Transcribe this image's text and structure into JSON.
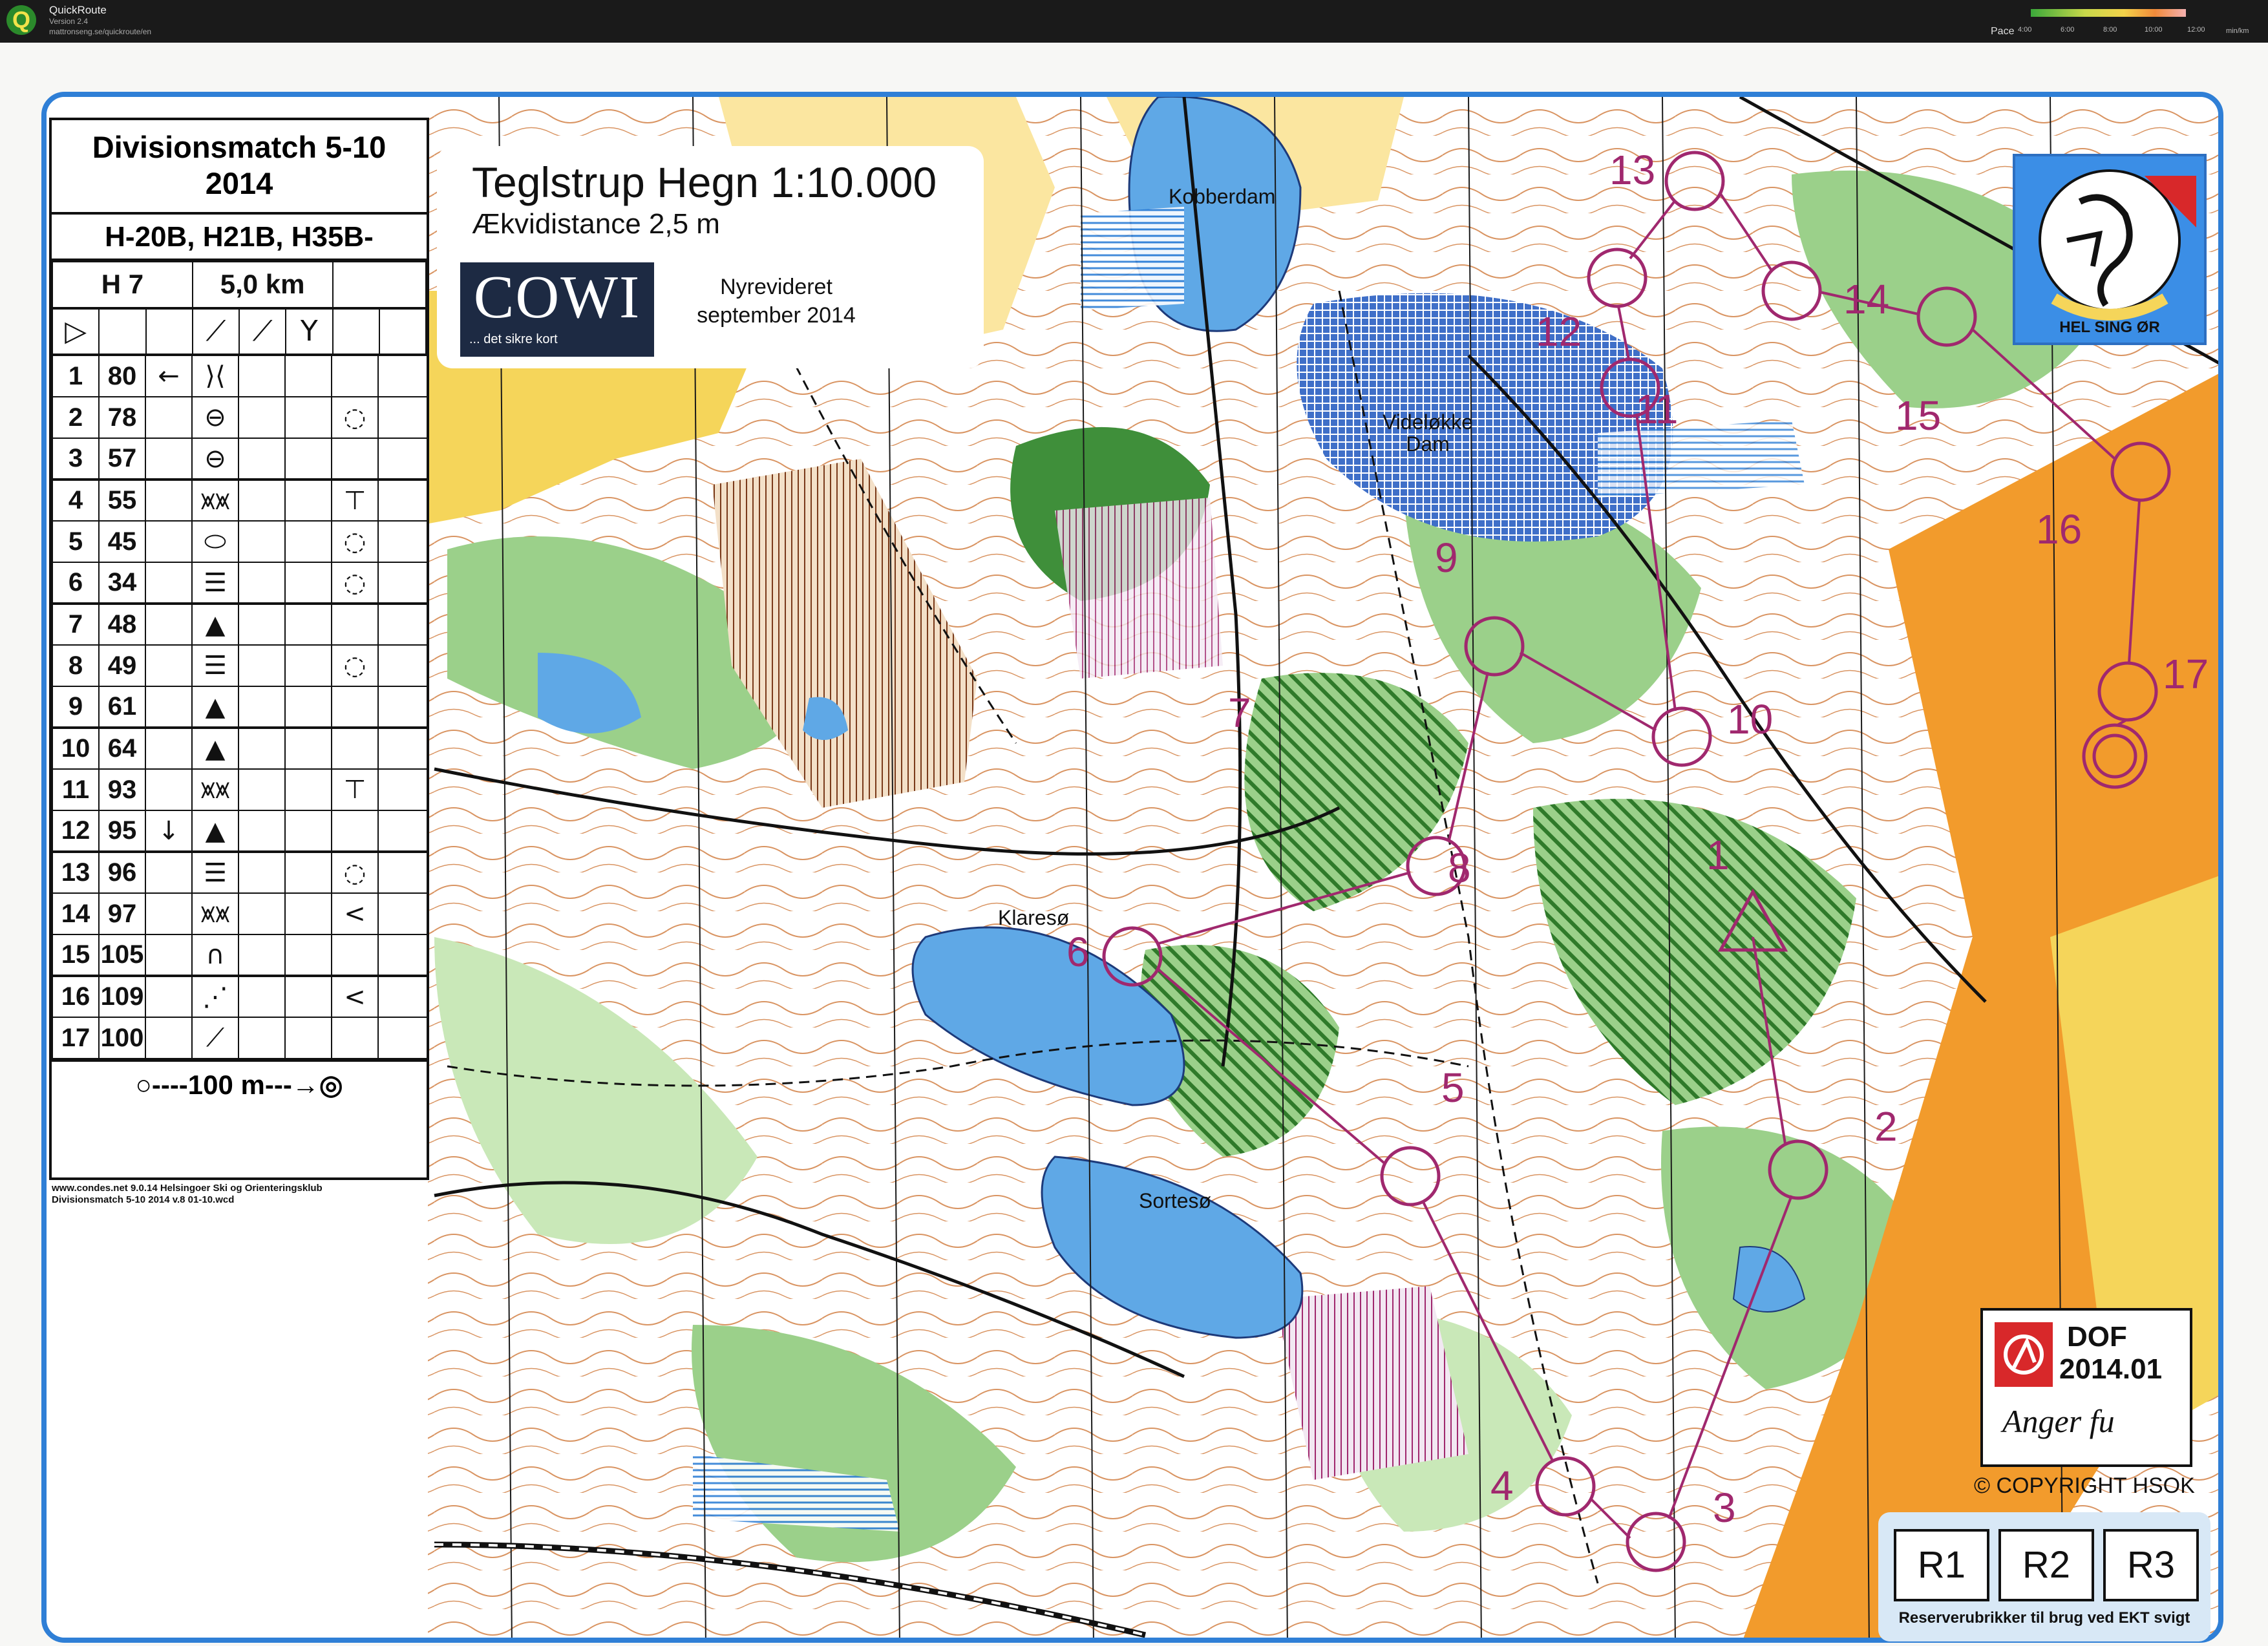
{
  "app": {
    "name": "QuickRoute",
    "version": "Version 2.4",
    "url": "mattronseng.se/quickroute/en",
    "pace_label": "Pace",
    "pace_unit": "min/km",
    "pace_ticks": [
      "4:00",
      "6:00",
      "8:00",
      "10:00",
      "12:00"
    ]
  },
  "description_sheet": {
    "event": "Divisionsmatch 5-10\n2014",
    "event_line1": "Divisionsmatch 5-10",
    "event_line2": "2014",
    "classes": "H-20B, H21B, H35B-",
    "course": "H 7",
    "length": "5,0 km",
    "controls": [
      {
        "num": "1",
        "code": "80",
        "col_d": "←",
        "feature": "⟩⟨",
        "col_h": ""
      },
      {
        "num": "2",
        "code": "78",
        "col_d": "",
        "feature": "⊖",
        "col_h": "◌"
      },
      {
        "num": "3",
        "code": "57",
        "col_d": "",
        "feature": "⊖",
        "col_h": ""
      },
      {
        "num": "4",
        "code": "55",
        "col_d": "",
        "feature": "⩙⩙",
        "col_h": "⊤"
      },
      {
        "num": "5",
        "code": "45",
        "col_d": "",
        "feature": "⬭",
        "col_h": "◌"
      },
      {
        "num": "6",
        "code": "34",
        "col_d": "",
        "feature": "☰",
        "col_h": "◌"
      },
      {
        "num": "7",
        "code": "48",
        "col_d": "",
        "feature": "▲",
        "col_h": ""
      },
      {
        "num": "8",
        "code": "49",
        "col_d": "",
        "feature": "☰",
        "col_h": "◌"
      },
      {
        "num": "9",
        "code": "61",
        "col_d": "",
        "feature": "▲",
        "col_h": ""
      },
      {
        "num": "10",
        "code": "64",
        "col_d": "",
        "feature": "▲",
        "col_h": ""
      },
      {
        "num": "11",
        "code": "93",
        "col_d": "",
        "feature": "⩙⩙",
        "col_h": "⊤"
      },
      {
        "num": "12",
        "code": "95",
        "col_d": "↓",
        "feature": "▲",
        "col_h": ""
      },
      {
        "num": "13",
        "code": "96",
        "col_d": "",
        "feature": "☰",
        "col_h": "◌"
      },
      {
        "num": "14",
        "code": "97",
        "col_d": "",
        "feature": "⩙⩙",
        "col_h": "<"
      },
      {
        "num": "15",
        "code": "105",
        "col_d": "",
        "feature": "∩",
        "col_h": ""
      },
      {
        "num": "16",
        "code": "109",
        "col_d": "",
        "feature": "⋰",
        "col_h": "<"
      },
      {
        "num": "17",
        "code": "100",
        "col_d": "",
        "feature": "⟋",
        "col_h": ""
      }
    ],
    "finish": "○----100 m---→◎",
    "credits_line1": "www.condes.net 9.0.14 Helsingoer Ski og Orienteringsklub",
    "credits_line2": "Divisionsmatch 5-10 2014 v.8 01-10.wcd"
  },
  "map": {
    "title": "Teglstrup Hegn 1:10.000",
    "contour_interval": "Ækvidistance 2,5  m",
    "mapper_logo": "COWI",
    "mapper_tagline": "... det sikre kort",
    "revision_line1": "Nyrevideret",
    "revision_line2": "september 2014",
    "club_logo_text": "HEL SING ØR",
    "place_names": [
      "Kobberdam",
      "Videløkke Dam",
      "Klaresø",
      "Sortesø"
    ],
    "course_numbers": [
      "1",
      "2",
      "3",
      "4",
      "5",
      "6",
      "7",
      "8",
      "9",
      "10",
      "11",
      "12",
      "13",
      "14",
      "15",
      "16",
      "17"
    ],
    "dof_title": "DOF",
    "dof_number": "2014.01",
    "dof_signature": "Anger fu",
    "copyright": "© COPYRIGHT HSOK",
    "reserve_boxes": [
      "R1",
      "R2",
      "R3"
    ],
    "reserve_note": "Reserverubrikker til brug ved EKT svigt",
    "colors": {
      "frame": "#2f7fd6",
      "water": "#5fa8e6",
      "open_land": "#f5d55a",
      "rough_open": "#fbe6a0",
      "green_vegetation": "#7cc26a",
      "dark_green": "#3f8f3a",
      "contours": "#c8661e",
      "course": "#a0286e",
      "urban_orange": "#f29b2c"
    }
  }
}
